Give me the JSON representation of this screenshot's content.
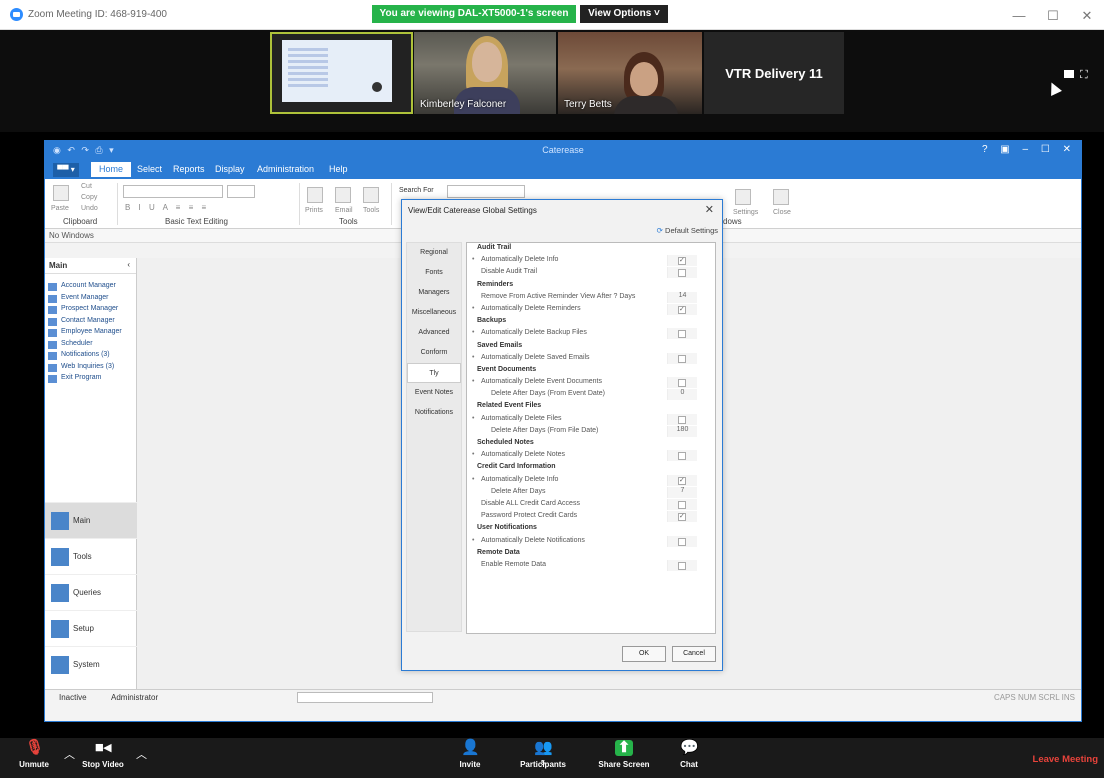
{
  "zoom": {
    "window_title": "Zoom Meeting ID: 468-919-400",
    "banner": "You are viewing DAL-XT5000-1's screen",
    "view_options": "View Options ˅",
    "win_controls": {
      "minimize": "—",
      "maximize": "☐",
      "close": "✕"
    }
  },
  "participants": [
    {
      "name": "Kimberley Falconer"
    },
    {
      "name": "Terry Betts"
    },
    {
      "name": "VTR Delivery 11"
    }
  ],
  "app": {
    "title": "Caterease",
    "title_controls": "? ▣ – ☐ ✕",
    "file_tab": "▀▀ ▾",
    "tabs": [
      "Home",
      "Select",
      "Reports",
      "Display",
      "Administration",
      "Help"
    ],
    "clipboard": {
      "cut": "Cut",
      "copy": "Copy",
      "undo": "Undo",
      "paste": "Paste",
      "group": "Clipboard"
    },
    "text_group": "Basic Text Editing",
    "tools_group": "Tools",
    "prints": "Prints",
    "email": "Email",
    "tools": "Tools",
    "search_label": "Search For",
    "settings": "Settings",
    "close": "Close",
    "windows": "dows",
    "no_windows": "No Windows",
    "nav_title": "Main",
    "nav_items": [
      "Account Manager",
      "Event Manager",
      "Prospect Manager",
      "Contact Manager",
      "Employee Manager",
      "Scheduler",
      "Notifications (3)",
      "Web Inquiries (3)",
      "Exit Program"
    ],
    "nav_big": [
      "Main",
      "Tools",
      "Queries",
      "Setup",
      "System"
    ],
    "nav_more": "···",
    "status": {
      "left": "Inactive",
      "user": "Administrator",
      "right": "CAPS NUM SCRL INS"
    }
  },
  "dialog": {
    "title": "View/Edit Caterease Global Settings",
    "close": "✕",
    "default_settings": "Default Settings",
    "nav": [
      "Regional",
      "Fonts",
      "Managers",
      "Miscellaneous",
      "Advanced",
      "Conform",
      "Tly",
      "Event Notes",
      "Notifications"
    ],
    "rows": [
      {
        "type": "header",
        "label": "Audit Trail"
      },
      {
        "type": "item",
        "label": "Automatically Delete Info",
        "check": true
      },
      {
        "type": "item",
        "label": "Disable Audit Trail",
        "check": false,
        "nobullet": true
      },
      {
        "type": "header",
        "label": "Reminders"
      },
      {
        "type": "item",
        "label": "Remove From Active Reminder View After ? Days",
        "value": "14",
        "nobullet": true
      },
      {
        "type": "item",
        "label": "Automatically Delete Reminders",
        "check": true
      },
      {
        "type": "header",
        "label": "Backups"
      },
      {
        "type": "item",
        "label": "Automatically Delete Backup Files",
        "check": false
      },
      {
        "type": "header",
        "label": "Saved Emails"
      },
      {
        "type": "item",
        "label": "Automatically Delete Saved Emails",
        "check": false
      },
      {
        "type": "header",
        "label": "Event Documents"
      },
      {
        "type": "item",
        "label": "Automatically Delete Event Documents",
        "check": false
      },
      {
        "type": "indent",
        "label": "Delete After Days (From Event Date)",
        "value": "0"
      },
      {
        "type": "header",
        "label": "Related Event Files"
      },
      {
        "type": "item",
        "label": "Automatically Delete Files",
        "check": false
      },
      {
        "type": "indent",
        "label": "Delete After Days (From File Date)",
        "value": "180"
      },
      {
        "type": "header",
        "label": "Scheduled Notes"
      },
      {
        "type": "item",
        "label": "Automatically Delete Notes",
        "check": false
      },
      {
        "type": "header",
        "label": "Credit Card Information"
      },
      {
        "type": "item",
        "label": "Automatically Delete Info",
        "check": true
      },
      {
        "type": "indent",
        "label": "Delete After Days",
        "value": "7"
      },
      {
        "type": "item",
        "label": "Disable ALL Credit Card Access",
        "check": false,
        "nobullet": true
      },
      {
        "type": "item",
        "label": "Password Protect Credit Cards",
        "check": true,
        "nobullet": true
      },
      {
        "type": "header",
        "label": "User Notifications"
      },
      {
        "type": "item",
        "label": "Automatically Delete Notifications",
        "check": false
      },
      {
        "type": "header",
        "label": "Remote Data"
      },
      {
        "type": "item",
        "label": "Enable Remote Data",
        "check": false,
        "nobullet": true
      }
    ],
    "ok": "OK",
    "cancel": "Cancel"
  },
  "toolbar": {
    "unmute": "Unmute",
    "stop_video": "Stop Video",
    "invite": "Invite",
    "participants": "Participants",
    "participants_count": "5",
    "share_screen": "Share Screen",
    "chat": "Chat",
    "leave": "Leave Meeting"
  },
  "colors": {
    "zoom_blue": "#2d8cff",
    "banner_green": "#26b34a",
    "leave_red": "#e8433b",
    "app_blue": "#2b7bd4"
  }
}
